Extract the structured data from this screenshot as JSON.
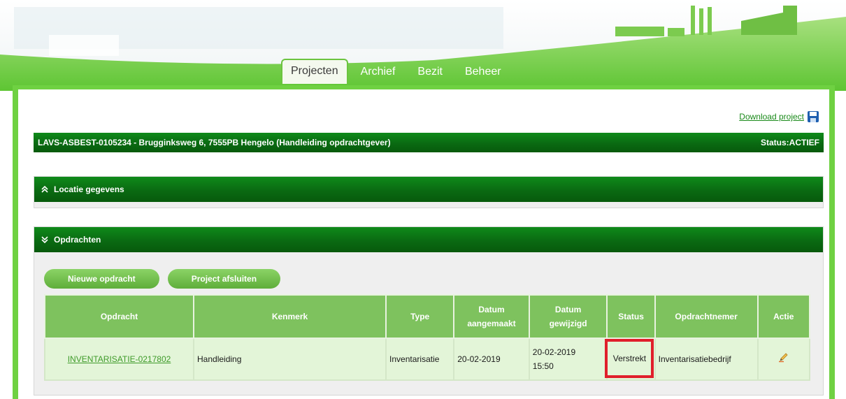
{
  "nav": {
    "tabs": [
      {
        "label": "Projecten",
        "active": true
      },
      {
        "label": "Archief",
        "active": false
      },
      {
        "label": "Bezit",
        "active": false
      },
      {
        "label": "Beheer",
        "active": false
      }
    ]
  },
  "download_label": "Download project",
  "project": {
    "title": "LAVS-ASBEST-0105234 - Brugginksweg 6, 7555PB Hengelo (Handleiding opdrachtgever)",
    "status": "Status:ACTIEF"
  },
  "sections": {
    "locatie": {
      "label": "Locatie gegevens",
      "icon": "collapse-up-icon"
    },
    "opdrachten": {
      "label": "Opdrachten",
      "icon": "expand-down-icon"
    }
  },
  "buttons": {
    "nieuwe_opdracht": "Nieuwe opdracht",
    "project_afsluiten": "Project afsluiten"
  },
  "table": {
    "headers": {
      "opdracht": "Opdracht",
      "kenmerk": "Kenmerk",
      "type": "Type",
      "datum_aangemaakt_1": "Datum",
      "datum_aangemaakt_2": "aangemaakt",
      "datum_gewijzigd_1": "Datum",
      "datum_gewijzigd_2": "gewijzigd",
      "status": "Status",
      "opdrachtnemer": "Opdrachtnemer",
      "actie": "Actie"
    },
    "rows": [
      {
        "opdracht": "INVENTARISATIE-0217802",
        "kenmerk": "Handleiding",
        "type": "Inventarisatie",
        "aangemaakt": "20-02-2019",
        "gewijzigd_date": "20-02-2019",
        "gewijzigd_time": "15:50",
        "status": "Verstrekt",
        "opdrachtnemer": "Inventarisatiebedrijf",
        "actie_icon": "pencil-icon"
      }
    ]
  },
  "colors": {
    "bar_dark": "#0a6a12",
    "frame_green": "#6fd142",
    "header_green": "#7ec25e",
    "highlight_red": "#e01f2b"
  }
}
